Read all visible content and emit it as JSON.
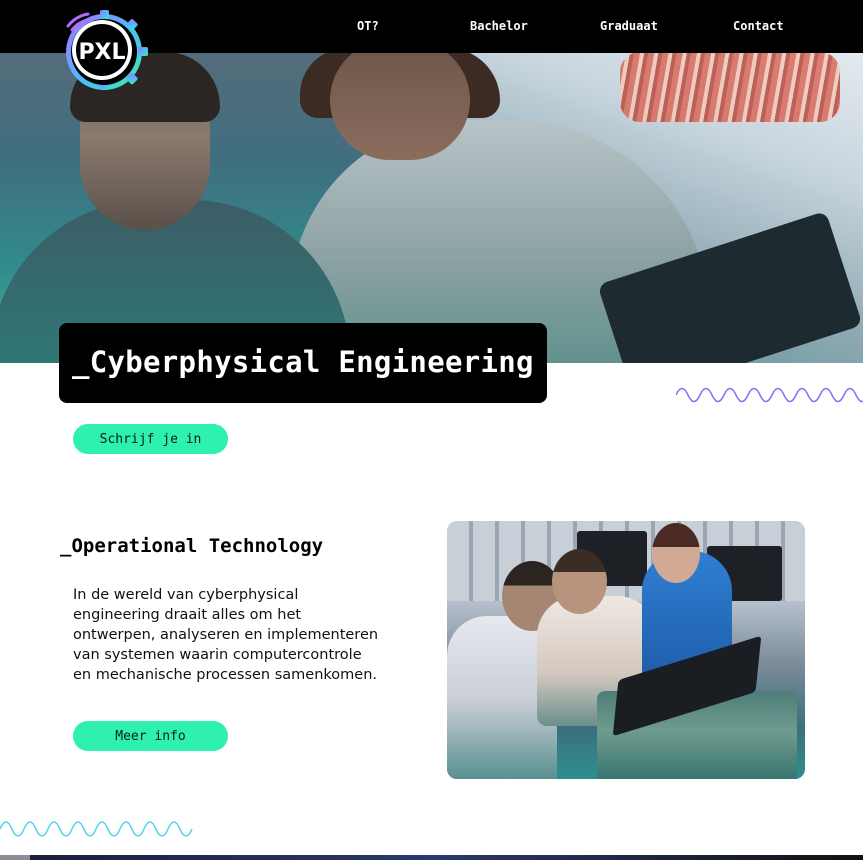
{
  "header": {
    "logo_text": "PXL",
    "nav": [
      {
        "label": "OT?"
      },
      {
        "label": "Bachelor"
      },
      {
        "label": "Graduaat"
      },
      {
        "label": "Contact"
      }
    ]
  },
  "hero": {
    "title": "_Cyberphysical Engineering",
    "cta_label": "Schrijf je in"
  },
  "section": {
    "title": "_Operational Technology",
    "body": "In de wereld van cyberphysical engineering draait alles om het ontwerpen, analyseren en implementeren van systemen waarin computercontrole en mechanische processen samenkomen.",
    "cta_label": "Meer info"
  },
  "colors": {
    "accent": "#2ef0b0",
    "header_bg": "#000000",
    "wave_purple": "#8a6cff",
    "wave_cyan": "#4fd1e6"
  }
}
